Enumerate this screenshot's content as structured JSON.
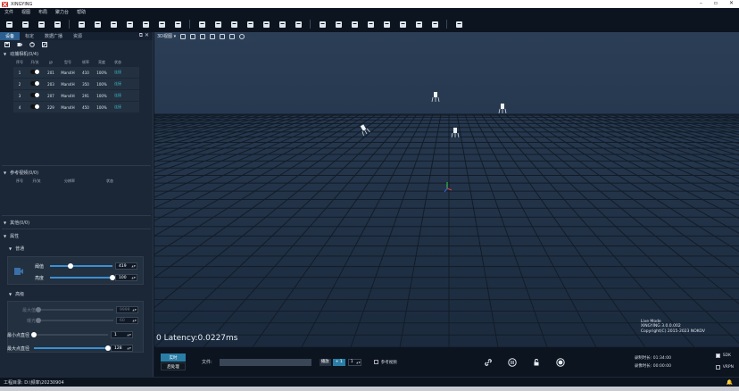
{
  "app": {
    "title": "XINGYING"
  },
  "window_controls": {
    "minimize": "–",
    "maximize": "▫",
    "close": "✕"
  },
  "menu": [
    "文件",
    "视图",
    "布局",
    "聚力台",
    "帮助"
  ],
  "toolbar_icons": [
    "open-file-icon",
    "save-icon",
    "save-as-icon",
    "export-icon",
    "wave-icon",
    "calibrate-icon",
    "camera-icon",
    "ruler-icon",
    "layers-icon",
    "grid-icon",
    "settings-gear-icon",
    "monitor-icon",
    "layout1-icon",
    "layout2-icon",
    "layout3-icon",
    "layout4-icon",
    "layout5-icon",
    "layout6-icon",
    "lock-icon",
    "record-icon",
    "target-icon",
    "cloud-icon",
    "skeleton-icon",
    "chart-icon",
    "pin-icon",
    "video-icon",
    "list-icon"
  ],
  "left_tabs": [
    "设备",
    "标定",
    "数据广播",
    "资源"
  ],
  "cameras": {
    "title": "动捕相机(0/4)",
    "columns": [
      "序号",
      "开/关",
      "IP",
      "型号",
      "帧率",
      "亮度",
      "状态"
    ],
    "rows": [
      {
        "index": "1",
        "ip": "201",
        "model": "Mars4H",
        "fps": "410",
        "brightness": "100%",
        "status": "连接"
      },
      {
        "index": "2",
        "ip": "203",
        "model": "Mars4H",
        "fps": "350",
        "brightness": "100%",
        "status": "连接"
      },
      {
        "index": "3",
        "ip": "207",
        "model": "Mars4H",
        "fps": "291",
        "brightness": "100%",
        "status": "连接"
      },
      {
        "index": "4",
        "ip": "229",
        "model": "Mars4H",
        "fps": "450",
        "brightness": "100%",
        "status": "连接"
      }
    ]
  },
  "reference": {
    "title": "参考视频(0/0)",
    "columns": [
      "序号",
      "开/关",
      "分辨率",
      "状态"
    ]
  },
  "others": {
    "title": "其他(0/0)"
  },
  "properties": {
    "title": "属性",
    "general_title": "普通",
    "threshold": {
      "label": "阈值",
      "value": "419",
      "fraction": 0.33
    },
    "brightness": {
      "label": "亮度",
      "value": "100",
      "fraction": 1.0
    },
    "advanced_title": "高级",
    "max_gain": {
      "label": "最大值",
      "value": "9999",
      "fraction": 0.0
    },
    "exposure": {
      "label": "曝光",
      "value": "60",
      "fraction": 0.0
    },
    "min_diameter": {
      "label": "最小点直径",
      "value": "1",
      "fraction": 0.0
    },
    "max_diameter": {
      "label": "最大点直径",
      "value": "128",
      "fraction": 1.0
    }
  },
  "viewport": {
    "view_label": "3D视图 ▾",
    "latency": "0 Latency:0.0227ms",
    "watermark": [
      "Live Mode",
      "XINGYING 3.0.0.002",
      "Copyright(C) 2015-2023 NOKOV"
    ]
  },
  "playback": {
    "live_label": "实时",
    "post_label": "后处理",
    "file_label": "文件:",
    "speed_label": "播放",
    "speed_step": "+ 1",
    "speed_value": "1",
    "reference_label": "参考视频",
    "record_time_label": "录制时长:",
    "record_time": "01:34:00",
    "total_time_label": "录像时长:",
    "total_time": "00:00:00",
    "sdk_label": "SDK",
    "vrpn_label": "VRPN",
    "sdk_checked": true,
    "vrpn_checked": false
  },
  "status": {
    "project_dir": "工程目录: D:\\频率\\20230904"
  }
}
